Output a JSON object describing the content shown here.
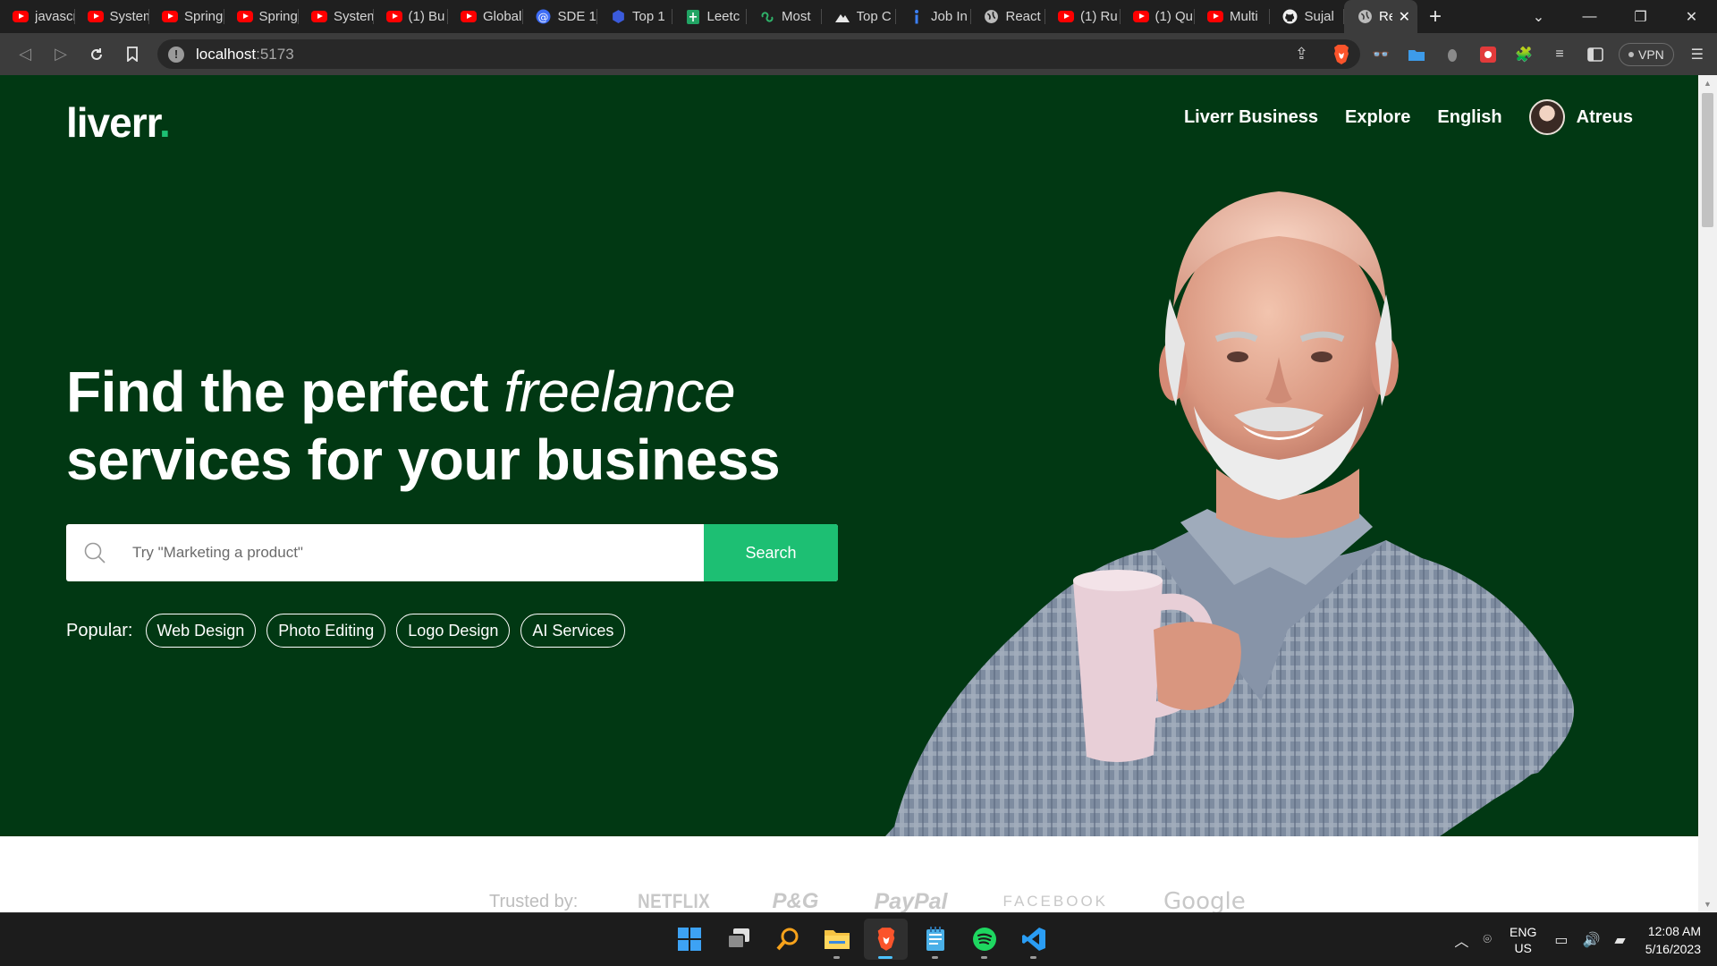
{
  "browser": {
    "tabs": [
      {
        "title": "javascript",
        "icon": "youtube-icon"
      },
      {
        "title": "System",
        "icon": "youtube-icon"
      },
      {
        "title": "Spring",
        "icon": "youtube-icon"
      },
      {
        "title": "Spring",
        "icon": "youtube-icon"
      },
      {
        "title": "System",
        "icon": "youtube-icon"
      },
      {
        "title": "(1) Bu",
        "icon": "youtube-icon"
      },
      {
        "title": "Global",
        "icon": "youtube-icon"
      },
      {
        "title": "SDE 1",
        "icon": "at-icon"
      },
      {
        "title": "Top 1",
        "icon": "hexagon-icon"
      },
      {
        "title": "Leetc",
        "icon": "sheets-icon"
      },
      {
        "title": "Most",
        "icon": "infinity-icon"
      },
      {
        "title": "Top C",
        "icon": "mountain-icon"
      },
      {
        "title": "Job In",
        "icon": "info-icon"
      },
      {
        "title": "React",
        "icon": "globe-icon"
      },
      {
        "title": "(1) Ru",
        "icon": "youtube-icon"
      },
      {
        "title": "(1) Qu",
        "icon": "youtube-icon"
      },
      {
        "title": "Multi",
        "icon": "youtube-icon"
      },
      {
        "title": "Sujal",
        "icon": "github-icon"
      }
    ],
    "active_tab": {
      "title": "Re",
      "icon": "globe-icon"
    },
    "address": {
      "host": "localhost",
      "port": ":5173"
    },
    "vpn_label": "VPN"
  },
  "site": {
    "logo": {
      "text": "liverr",
      "dot": "."
    },
    "nav": {
      "business": "Liverr Business",
      "explore": "Explore",
      "language": "English",
      "username": "Atreus"
    },
    "hero": {
      "headline_part1": "Find the perfect ",
      "headline_italic": "freelance",
      "headline_line2": "services for your business",
      "search_placeholder": "Try \"Marketing a product\"",
      "search_button": "Search",
      "popular_label": "Popular:",
      "popular_tags": [
        "Web Design",
        "Photo Editing",
        "Logo Design",
        "AI Services"
      ]
    },
    "trusted": {
      "label": "Trusted by:",
      "brands": [
        "NETFLIX",
        "P&G",
        "PayPal",
        "FACEBOOK",
        "Google"
      ]
    },
    "colors": {
      "hero_bg": "#013813",
      "accent": "#1dbf73"
    }
  },
  "taskbar": {
    "apps": [
      "start-icon",
      "task-view-icon",
      "search-icon",
      "file-explorer-icon",
      "brave-icon",
      "notepad-icon",
      "spotify-icon",
      "vscode-icon"
    ],
    "lang_line1": "ENG",
    "lang_line2": "US",
    "time": "12:08 AM",
    "date": "5/16/2023"
  }
}
